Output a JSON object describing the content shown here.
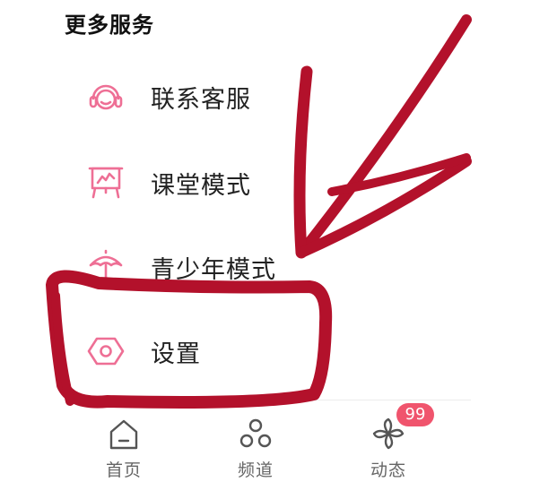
{
  "section": {
    "title": "更多服务"
  },
  "menu": {
    "items": [
      {
        "label": "联系客服",
        "icon": "headset-icon"
      },
      {
        "label": "课堂模式",
        "icon": "presentation-board-icon"
      },
      {
        "label": "青少年模式",
        "icon": "umbrella-icon"
      },
      {
        "label": "设置",
        "icon": "settings-hexagon-icon"
      }
    ]
  },
  "bottom_nav": {
    "items": [
      {
        "label": "首页",
        "icon": "home-icon"
      },
      {
        "label": "频道",
        "icon": "channel-icon"
      },
      {
        "label": "动态",
        "icon": "pinwheel-icon",
        "badge": "99"
      }
    ]
  },
  "colors": {
    "accent_pink": "#ee6f95",
    "annotation_red": "#b3112b",
    "badge_bg": "#f0546d"
  }
}
